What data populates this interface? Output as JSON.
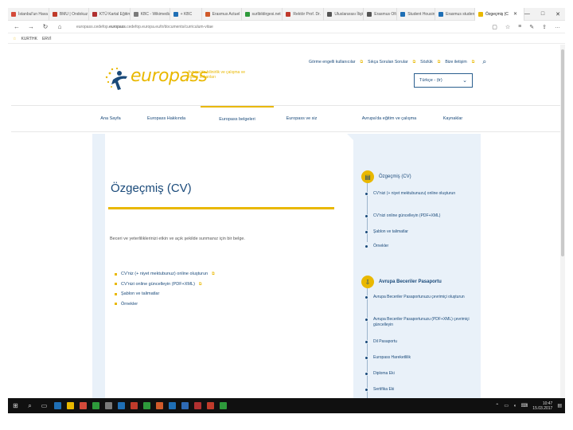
{
  "browser": {
    "tabs": [
      {
        "label": "İstanbul'un Hava",
        "color": "#d44a3a"
      },
      {
        "label": "BMU | Ondokuz",
        "color": "#c03b2b"
      },
      {
        "label": "KTÜ Kartal Eğitim",
        "color": "#b03030"
      },
      {
        "label": "KBC - Wikimedia",
        "color": "#7a7a7a"
      },
      {
        "label": "+ KBC",
        "color": "#1f6fb5"
      },
      {
        "label": "Erasmus Actuel",
        "color": "#d05a2a"
      },
      {
        "label": "surlbildirgesi.net",
        "color": "#2e9a3b"
      },
      {
        "label": "Rektör Prof. Dr.",
        "color": "#c0392b"
      },
      {
        "label": "Uluslararası İlişki",
        "color": "#555555"
      },
      {
        "label": "Erasmus Ofisi",
        "color": "#555555"
      },
      {
        "label": "Student Housing",
        "color": "#1f6fb5"
      },
      {
        "label": "Erasmus student",
        "color": "#1f6fb5"
      },
      {
        "label": "Özgeçmiş (C",
        "color": "#e9b800",
        "active": true
      }
    ],
    "url_prefix": "europass.cedefop.",
    "url_domain": "europass",
    "url_rest": ".cedefop.europa.eu/tr/documents/curriculum-vitae",
    "favorites": [
      "KURTHK",
      "ERVİ"
    ],
    "window_controls": [
      "—",
      "□",
      "✕"
    ]
  },
  "page": {
    "util_nav": [
      "Görme engelli kullanıcılar",
      "Sıkça Sorulan Sorular",
      "Sözlük",
      "Bize iletişim"
    ],
    "logo_text": "europass",
    "logo_tagline": "Avrupa'da bilinirlik ve çalışma ve eğitim imkanları",
    "language": "Türkçe - (tr)",
    "main_nav": [
      "Ana Sayfa",
      "Europass Hakkında",
      "Europass belgeleri",
      "Europass ve siz",
      "Avrupa'da eğitim ve çalışma",
      "Kaynaklar"
    ],
    "active_nav_index": 2,
    "cv_title": "Özgeçmiş (CV)",
    "intro": "Beceri ve yeterliliklerinizi etkin ve açık şekilde sunmanız için bir belge.",
    "cv_links": [
      "CV'niz (+ niyet mektubunuz) online oluşturun",
      "CV'nizi online güncelleyin (PDF+XML)",
      "Şablon ve talimatlar",
      "Örnekler"
    ],
    "side_sections": [
      {
        "title": "Özgeçmiş (CV)",
        "bold": false,
        "icon": "document-icon",
        "items": [
          "CV'nizi (+ niyet mektubunuzu) online oluşturun",
          "CV'nizi online güncelleyin (PDF+XML)",
          "Şablon ve talimatlar",
          "Örnekler"
        ]
      },
      {
        "title": "Avrupa Beceriler Pasaportu",
        "bold": true,
        "icon": "download-icon",
        "items": [
          "Avrupa Beceriler Pasaportunuzu çevrimiçi oluşturun",
          "Avrupa Beceriler Pasaportunuzu (PDF+XML) çevrimiçi güncelleyin",
          "Dil Pasaportu",
          "Europass Hareketlilik",
          "Diploma Eki",
          "Sertifika Eki"
        ]
      }
    ]
  },
  "taskbar": {
    "apps": [
      "#1f6fb5",
      "#e9b800",
      "#d44a3a",
      "#2e9a3b",
      "#7a7a7a",
      "#1f6fb5",
      "#c03b2b",
      "#2e9a3b",
      "#d05a2a",
      "#1f6fb5",
      "#2e6ab5",
      "#b03030",
      "#c03b2b",
      "#2e9a3b"
    ],
    "time": "10:47",
    "date": "15.03.2017"
  },
  "colors": {
    "brand_yellow": "#e9b800",
    "brand_blue": "#1a4a7a",
    "content_bg": "#e9f1f9"
  }
}
